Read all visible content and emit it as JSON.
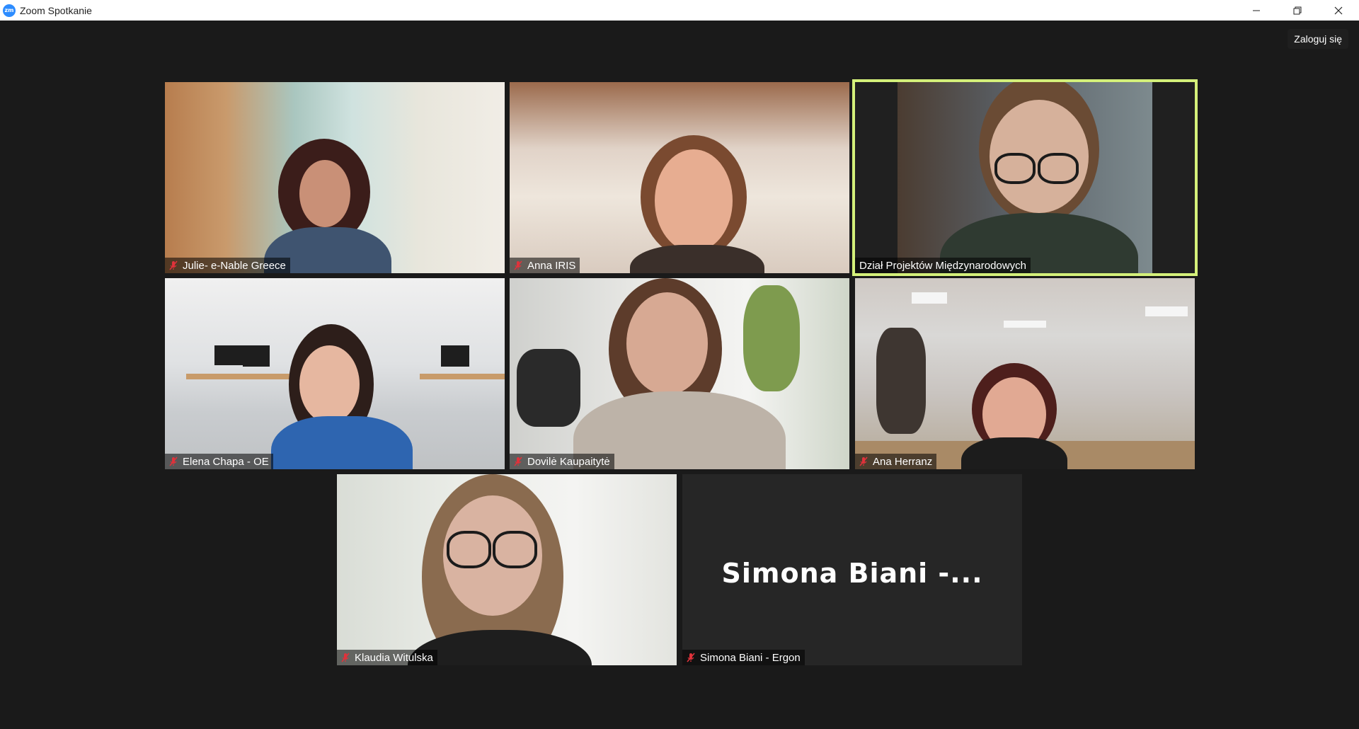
{
  "window": {
    "title": "Zoom Spotkanie",
    "logo_text": "zm",
    "controls": [
      "minimize-icon",
      "restore-icon",
      "close-icon"
    ]
  },
  "header": {
    "signin_label": "Zaloguj się"
  },
  "colors": {
    "active_speaker_border": "#d4f07a",
    "background": "#1a1a1a",
    "muted_icon": "#e0323b"
  },
  "participants": [
    {
      "name": "Julie- e-Nable Greece",
      "muted": true,
      "video": true
    },
    {
      "name": "Anna IRIS",
      "muted": true,
      "video": true
    },
    {
      "name": "Dział Projektów Międzynarodowych",
      "muted": false,
      "video": true,
      "active_speaker": true
    },
    {
      "name": "Elena Chapa - OE",
      "muted": true,
      "video": true
    },
    {
      "name": "Dovilė Kaupaitytė",
      "muted": true,
      "video": true
    },
    {
      "name": "Ana Herranz",
      "muted": true,
      "video": true
    },
    {
      "name": "Klaudia Witulska",
      "muted": true,
      "video": true
    },
    {
      "name": "Simona Biani - Ergon",
      "muted": true,
      "video": false,
      "display_name_short": "Simona Biani -..."
    }
  ]
}
